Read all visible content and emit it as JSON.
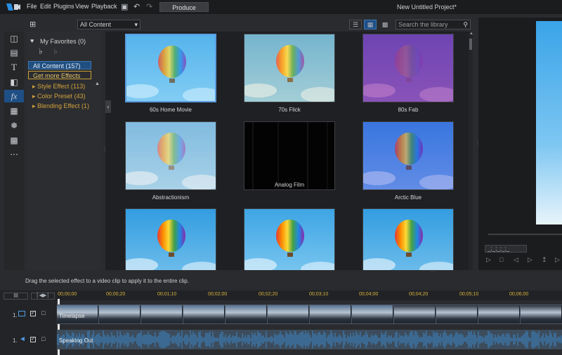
{
  "menubar": {
    "items": [
      "File",
      "Edit",
      "Plugins",
      "View",
      "Playback"
    ],
    "produce": "Produce",
    "project_title": "New Untitled Project*"
  },
  "library": {
    "content_select": "All Content",
    "search_placeholder": "Search the library"
  },
  "panel": {
    "favorites": "My Favorites (0)",
    "all_content": "All Content (157)",
    "get_more": "Get more Effects",
    "categories": [
      {
        "label": "Style Effect",
        "count": "(113)"
      },
      {
        "label": "Color Preset",
        "count": "(43)"
      },
      {
        "label": "Blending Effect",
        "count": "(1)"
      }
    ]
  },
  "effects": [
    {
      "label": "60s Home Movie"
    },
    {
      "label": "70s Flick"
    },
    {
      "label": "80s Fab"
    },
    {
      "label": "Abstractionism"
    },
    {
      "label": "Analog Film"
    },
    {
      "label": "Arctic Blue"
    },
    {
      "label": ""
    },
    {
      "label": ""
    },
    {
      "label": ""
    }
  ],
  "hint": "Drag the selected effect to a video clip to apply it to the entire clip.",
  "timeline": {
    "ticks": [
      "00;00;00",
      "00;00;20",
      "00;01;10",
      "00;02;00",
      "00;02;20",
      "00;03;10",
      "00;04;00",
      "00;04;20",
      "00;05;10",
      "00;06;00"
    ],
    "video_track": {
      "number": "1.",
      "clip": "Timelapse"
    },
    "audio_track": {
      "number": "1.",
      "clip": "Speaking Out"
    }
  },
  "preview": {
    "timecode": "_;_;_;_;_"
  },
  "colors": {
    "accent": "#1e4f86",
    "selection": "#5a9be0",
    "category": "#d1a23d",
    "timecode": "#d8b440"
  }
}
